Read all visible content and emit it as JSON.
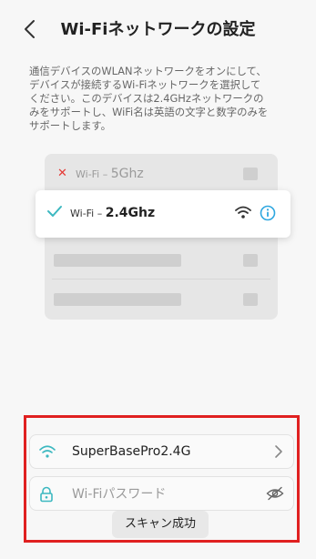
{
  "header": {
    "title": "Wi-Fiネットワークの設定"
  },
  "description": "通信デバイスのWLANネットワークをオンにして、\nデバイスが接続するWi-Fiネットワークを選択して\nください。このデバイスは2.4GHzネットワークの\nみをサポートし、WiFi名は英語の文字と数字のみを\nサポートします。",
  "illustration": {
    "unsupported_prefix": "Wi-Fi –",
    "unsupported_band": "5Ghz",
    "supported_prefix": "Wi-Fi –",
    "supported_band": "2.4Ghz"
  },
  "form": {
    "ssid_value": "SuperBasePro2.4G",
    "password_placeholder": "Wi-Fiパスワード"
  },
  "toast": "スキャン成功",
  "colors": {
    "accent": "#2ea7e0",
    "check": "#3cb8c0",
    "error": "#e53935",
    "highlight_border": "#e02020"
  },
  "icons": {
    "back": "chevron-left-icon",
    "cross": "cross-icon",
    "check": "check-icon",
    "wifi": "wifi-icon",
    "info": "info-icon",
    "lock": "lock-icon",
    "chevron": "chevron-right-icon",
    "eye": "eye-off-icon"
  }
}
